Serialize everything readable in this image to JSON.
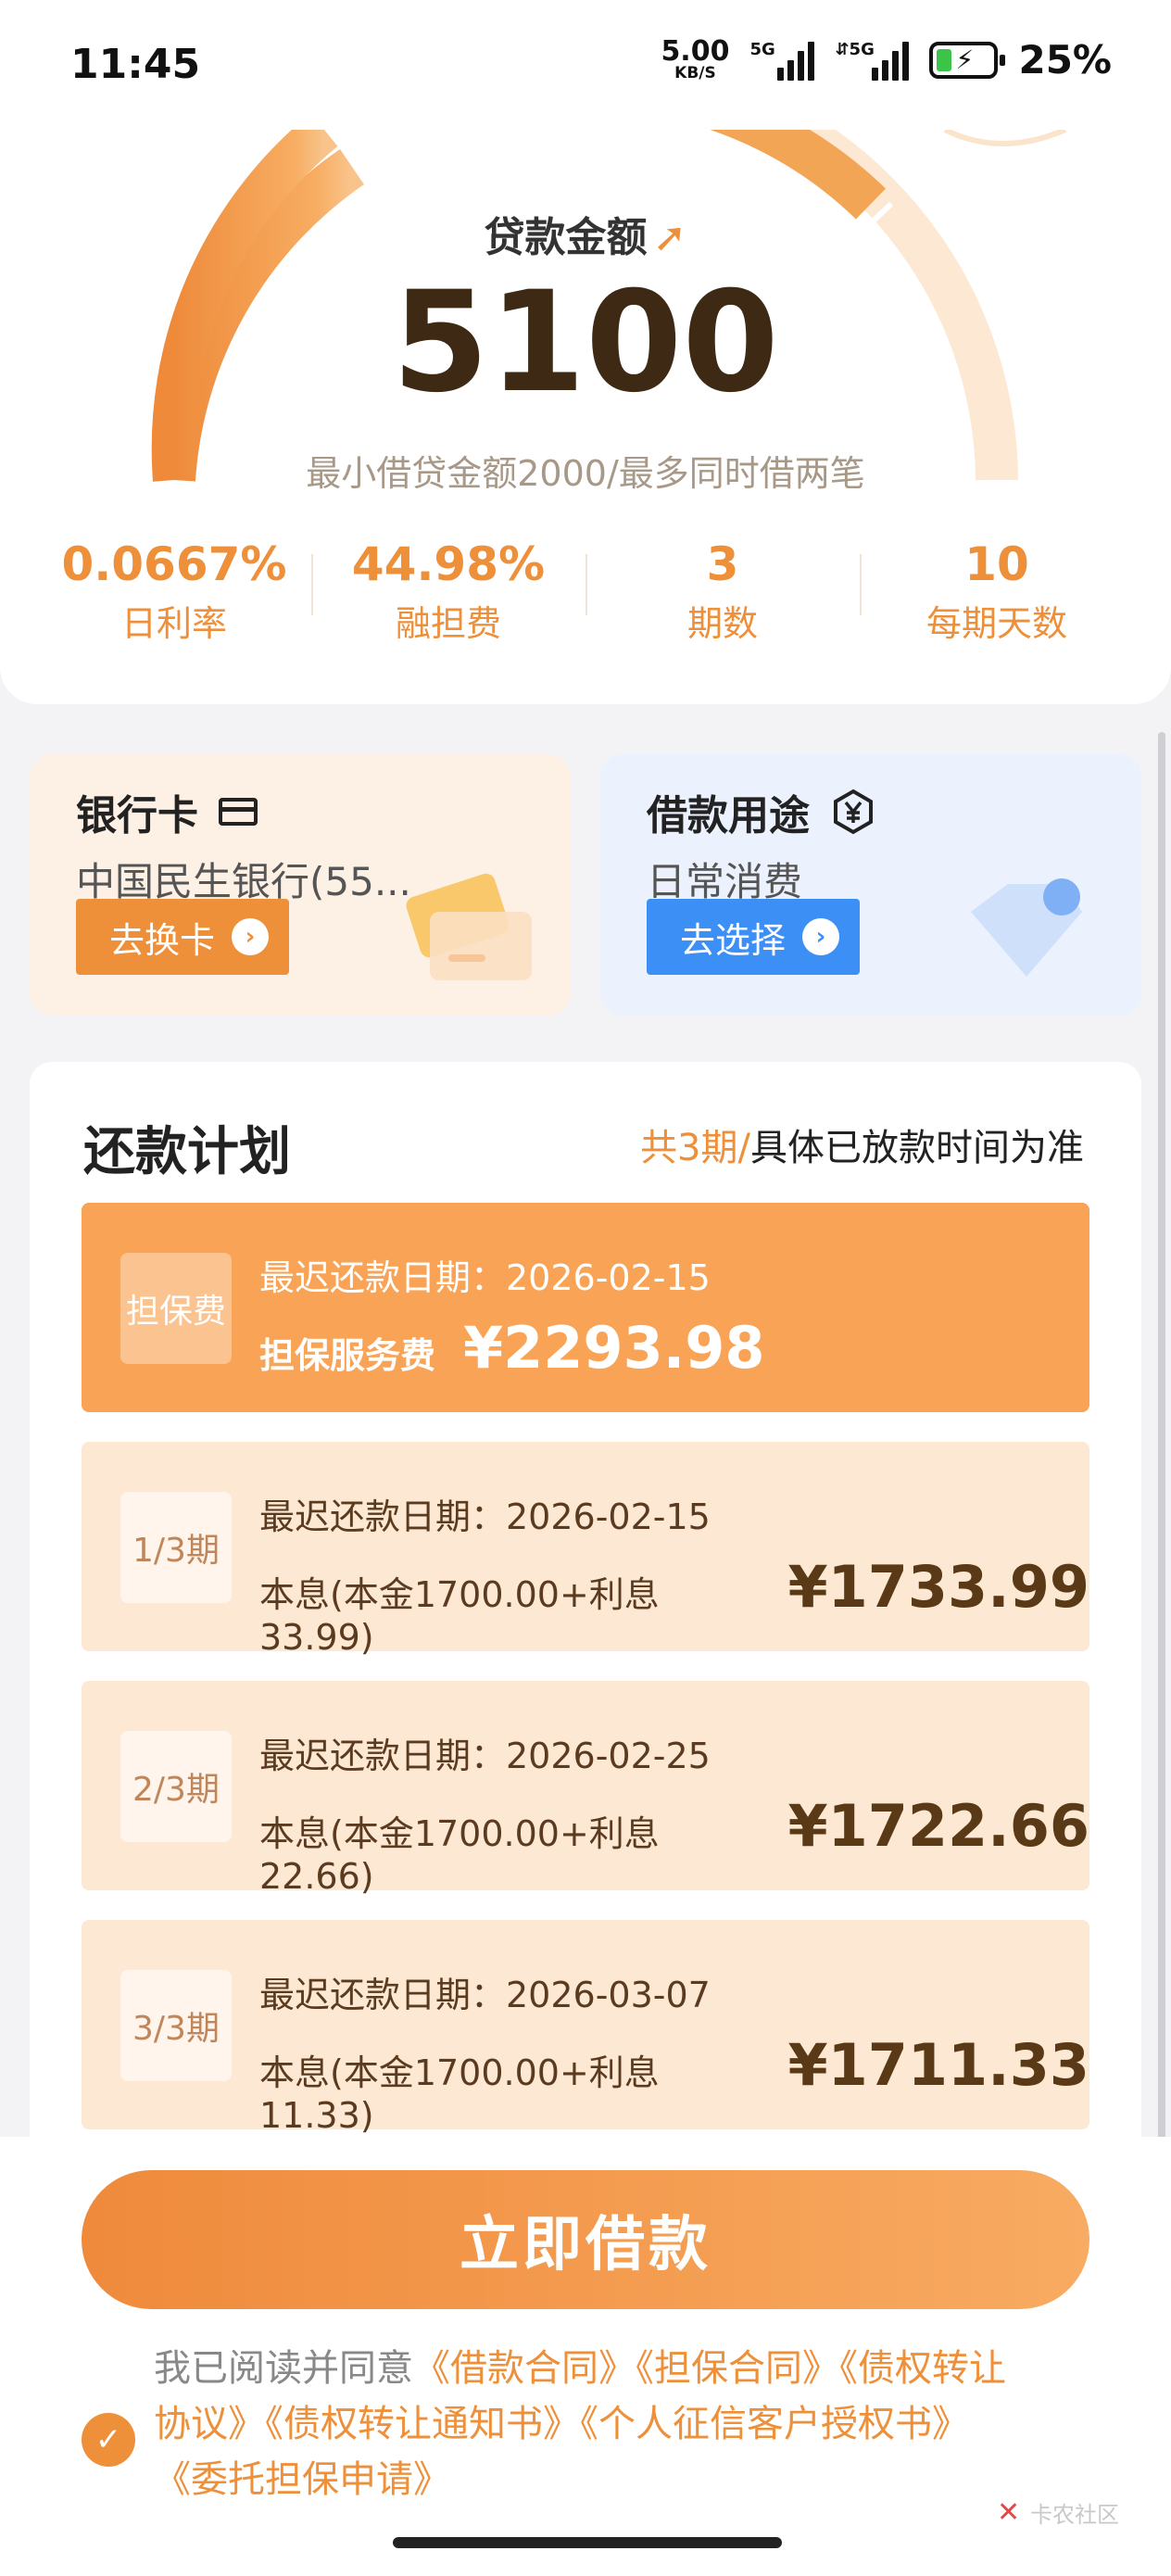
{
  "status_bar": {
    "time": "11:45",
    "net_speed": "5.00",
    "net_unit": "KB/S",
    "sig1_tag": "5G",
    "sig2_tag": "⇵5G",
    "battery": "25%"
  },
  "loan": {
    "label": "贷款金额",
    "amount": "5100",
    "hint": "最小借贷金额2000/最多同时借两笔"
  },
  "stats": [
    {
      "value": "0.0667%",
      "label": "日利率"
    },
    {
      "value": "44.98%",
      "label": "融担费"
    },
    {
      "value": "3",
      "label": "期数"
    },
    {
      "value": "10",
      "label": "每期天数"
    }
  ],
  "bank_card": {
    "title": "银行卡",
    "value": "中国民生银行(55...",
    "button": "去换卡"
  },
  "loan_use": {
    "title": "借款用途",
    "value": "日常消费",
    "button": "去选择"
  },
  "plan": {
    "title": "还款计划",
    "note_highlight": "共3期/",
    "note_rest": "具体已放款时间为准",
    "fee_row": {
      "badge": "担保费",
      "date": "最迟还款日期：2026-02-15",
      "desc": "担保服务费",
      "amount": "¥2293.98"
    },
    "installments": [
      {
        "badge": "1/3期",
        "date": "最迟还款日期：2026-02-15",
        "desc": "本息(本金1700.00+利息33.99)",
        "amount": "¥1733.99"
      },
      {
        "badge": "2/3期",
        "date": "最迟还款日期：2026-02-25",
        "desc": "本息(本金1700.00+利息22.66)",
        "amount": "¥1722.66"
      },
      {
        "badge": "3/3期",
        "date": "最迟还款日期：2026-03-07",
        "desc": "本息(本金1700.00+利息11.33)",
        "amount": "¥1711.33"
      }
    ]
  },
  "cta": "立即借款",
  "agreement": {
    "prefix": "我已阅读并同意",
    "line1_links": "《借款合同》《担保合同》《债权转让",
    "line2": "协议》《债权转让通知书》《个人征信客户授权书》",
    "line3": "《委托担保申请》"
  },
  "watermark": "卡农社区",
  "colors": {
    "accent": "#ee8f3a",
    "blue": "#3c8ff5",
    "amount_dark": "#3d2914"
  },
  "icons": [
    "arrow-up-right-icon",
    "bank-card-icon",
    "yuan-hexagon-icon",
    "chevron-right-icon",
    "check-icon"
  ]
}
